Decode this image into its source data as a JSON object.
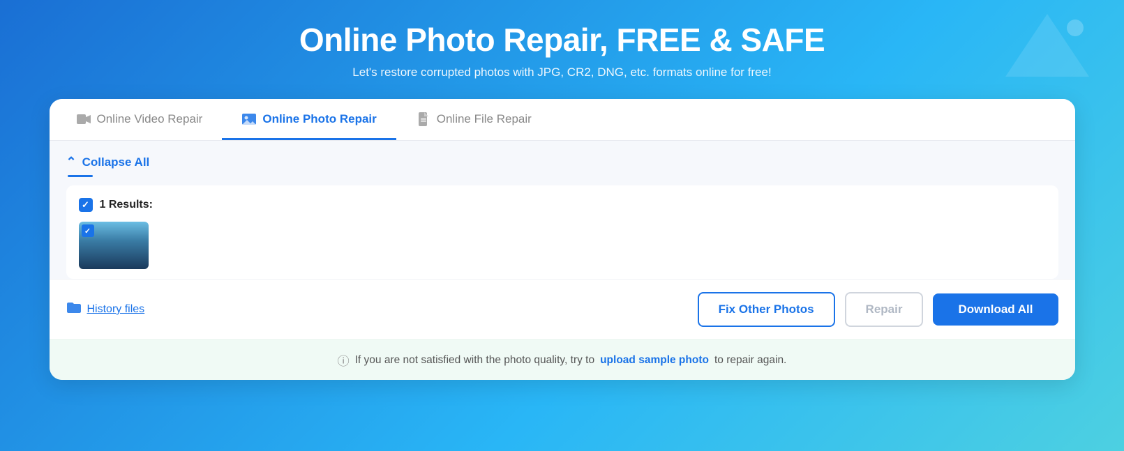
{
  "header": {
    "title": "Online Photo Repair, FREE & SAFE",
    "subtitle": "Let's restore corrupted photos with JPG, CR2, DNG, etc. formats online for free!"
  },
  "tabs": [
    {
      "id": "video",
      "label": "Online Video Repair",
      "icon": "🎬",
      "active": false
    },
    {
      "id": "photo",
      "label": "Online Photo Repair",
      "icon": "🖼",
      "active": true
    },
    {
      "id": "file",
      "label": "Online File Repair",
      "icon": "📄",
      "active": false
    }
  ],
  "collapse_all_label": "Collapse All",
  "results": {
    "count_label": "1 Results:"
  },
  "footer": {
    "history_label": "History files",
    "fix_other_label": "Fix Other Photos",
    "repair_label": "Repair",
    "download_all_label": "Download All"
  },
  "info_bar": {
    "prefix": "If you are not satisfied with the photo quality, try to",
    "link_text": "upload sample photo",
    "suffix": "to repair again."
  }
}
